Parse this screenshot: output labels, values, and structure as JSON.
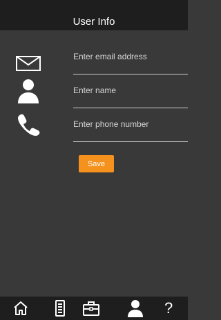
{
  "header": {
    "title": "User Info"
  },
  "form": {
    "email": {
      "value": "",
      "placeholder": "Enter email address",
      "icon": "envelope-icon"
    },
    "name": {
      "value": "",
      "placeholder": "Enter name",
      "icon": "person-icon"
    },
    "phone": {
      "value": "",
      "placeholder": "Enter phone number",
      "icon": "phone-icon"
    },
    "save_label": "Save"
  },
  "tabbar": {
    "items": [
      {
        "icon": "home-icon"
      },
      {
        "icon": "list-document-icon"
      },
      {
        "icon": "briefcase-icon"
      },
      {
        "icon": "person-icon",
        "active": true
      },
      {
        "icon": "help-icon",
        "glyph": "?"
      }
    ]
  },
  "colors": {
    "background": "#393939",
    "bar": "#1e1e1e",
    "accent": "#f5921e",
    "text": "#ffffff",
    "divider": "#d0d0d0"
  }
}
